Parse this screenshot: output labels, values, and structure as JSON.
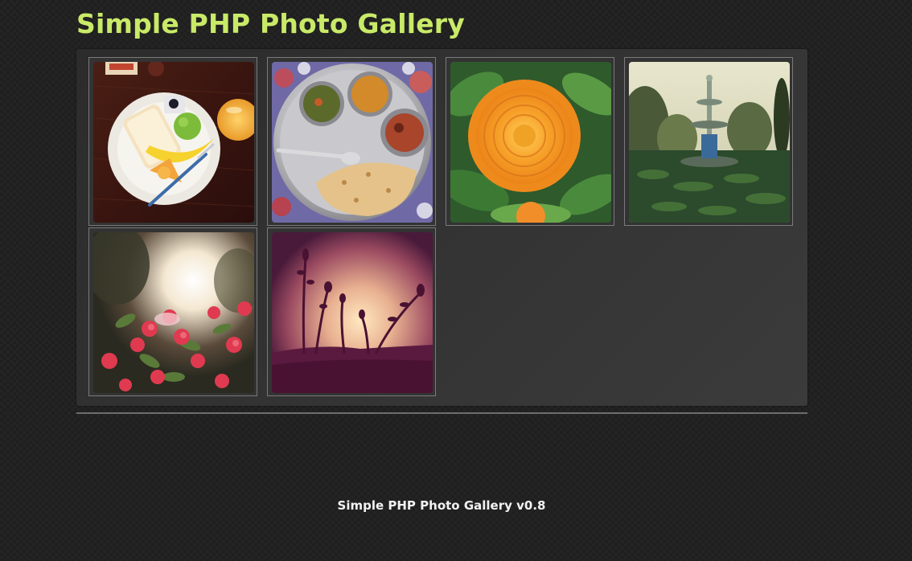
{
  "header": {
    "title": "Simple PHP Photo Gallery"
  },
  "gallery": {
    "thumbnails": [
      {
        "subject": "breakfast-plate-photo"
      },
      {
        "subject": "thali-meal-photo"
      },
      {
        "subject": "orange-flower-photo"
      },
      {
        "subject": "garden-fountain-photo"
      },
      {
        "subject": "red-flowers-sunset-photo"
      },
      {
        "subject": "plant-silhouette-sunset-photo"
      }
    ]
  },
  "footer": {
    "text": "Simple PHP Photo Gallery v0.8"
  },
  "colors": {
    "title": "#c9ea68",
    "background": "#1f1f1f",
    "panel": "#333333",
    "footer_text": "#f2f2f2"
  }
}
